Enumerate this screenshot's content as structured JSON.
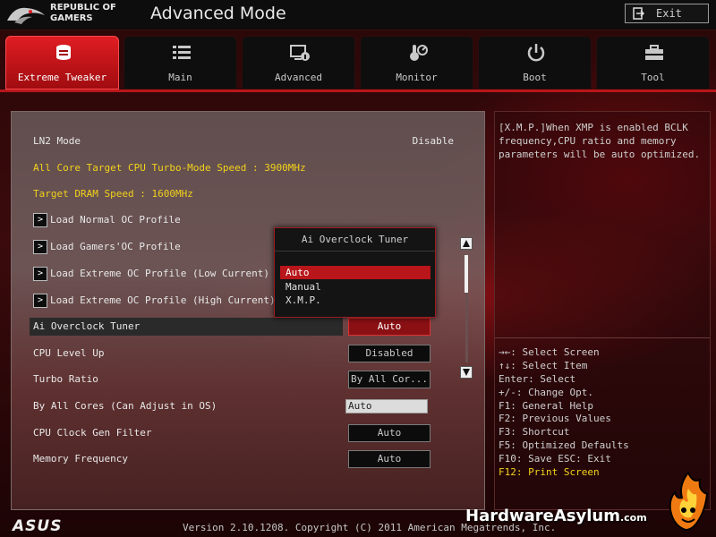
{
  "header": {
    "brand_line1": "REPUBLIC OF",
    "brand_line2": "GAMERS",
    "mode_title": "Advanced Mode",
    "exit_label": "Exit"
  },
  "tabs": [
    {
      "label": "Extreme Tweaker",
      "icon": "tweaker-icon",
      "active": true
    },
    {
      "label": "Main",
      "icon": "list-icon",
      "active": false
    },
    {
      "label": "Advanced",
      "icon": "advanced-icon",
      "active": false
    },
    {
      "label": "Monitor",
      "icon": "monitor-icon",
      "active": false
    },
    {
      "label": "Boot",
      "icon": "power-icon",
      "active": false
    },
    {
      "label": "Tool",
      "icon": "toolbox-icon",
      "active": false
    }
  ],
  "settings": {
    "ln2_label": "LN2 Mode",
    "ln2_value": "Disable",
    "turbo_speed_info": "All Core Target CPU Turbo-Mode Speed : 3900MHz",
    "dram_speed_info": "Target DRAM Speed : 1600MHz",
    "profiles": [
      "Load Normal OC Profile",
      "Load Gamers'OC Profile",
      "Load Extreme OC Profile (Low Current)",
      "Load Extreme OC Profile (High Current)"
    ],
    "ai_tuner_label": "Ai Overclock Tuner",
    "ai_tuner_value": "Auto",
    "cpu_level_label": "CPU Level Up",
    "cpu_level_value": "Disabled",
    "turbo_ratio_label": "Turbo Ratio",
    "turbo_ratio_value": "By All Cor...",
    "all_cores_label": "By All Cores (Can Adjust in OS)",
    "all_cores_value": "Auto",
    "clock_gen_label": "CPU Clock Gen Filter",
    "clock_gen_value": "Auto",
    "mem_freq_label": "Memory Frequency",
    "mem_freq_value": "Auto"
  },
  "popup": {
    "title": "Ai Overclock Tuner",
    "options": [
      "Auto",
      "Manual",
      "X.M.P."
    ],
    "selected_index": 0
  },
  "help": {
    "description": "[X.M.P.]When XMP is enabled BCLK frequency,CPU ratio and memory parameters will be auto optimized.",
    "keys": [
      "→←: Select Screen",
      "↑↓: Select Item",
      "Enter: Select",
      "+/-: Change Opt.",
      "F1: General Help",
      "F2: Previous Values",
      "F3: Shortcut",
      "F5: Optimized Defaults",
      "F10: Save  ESC: Exit",
      "F12: Print Screen"
    ]
  },
  "footer": {
    "asus_logo": "ASUS",
    "version": "Version 2.10.1208. Copyright (C) 2011 American Megatrends, Inc."
  },
  "watermark": {
    "main": "HardwareAsylum",
    "suffix": ".com"
  },
  "colors": {
    "accent_red": "#b8161a",
    "info_yellow": "#f2d21a"
  }
}
